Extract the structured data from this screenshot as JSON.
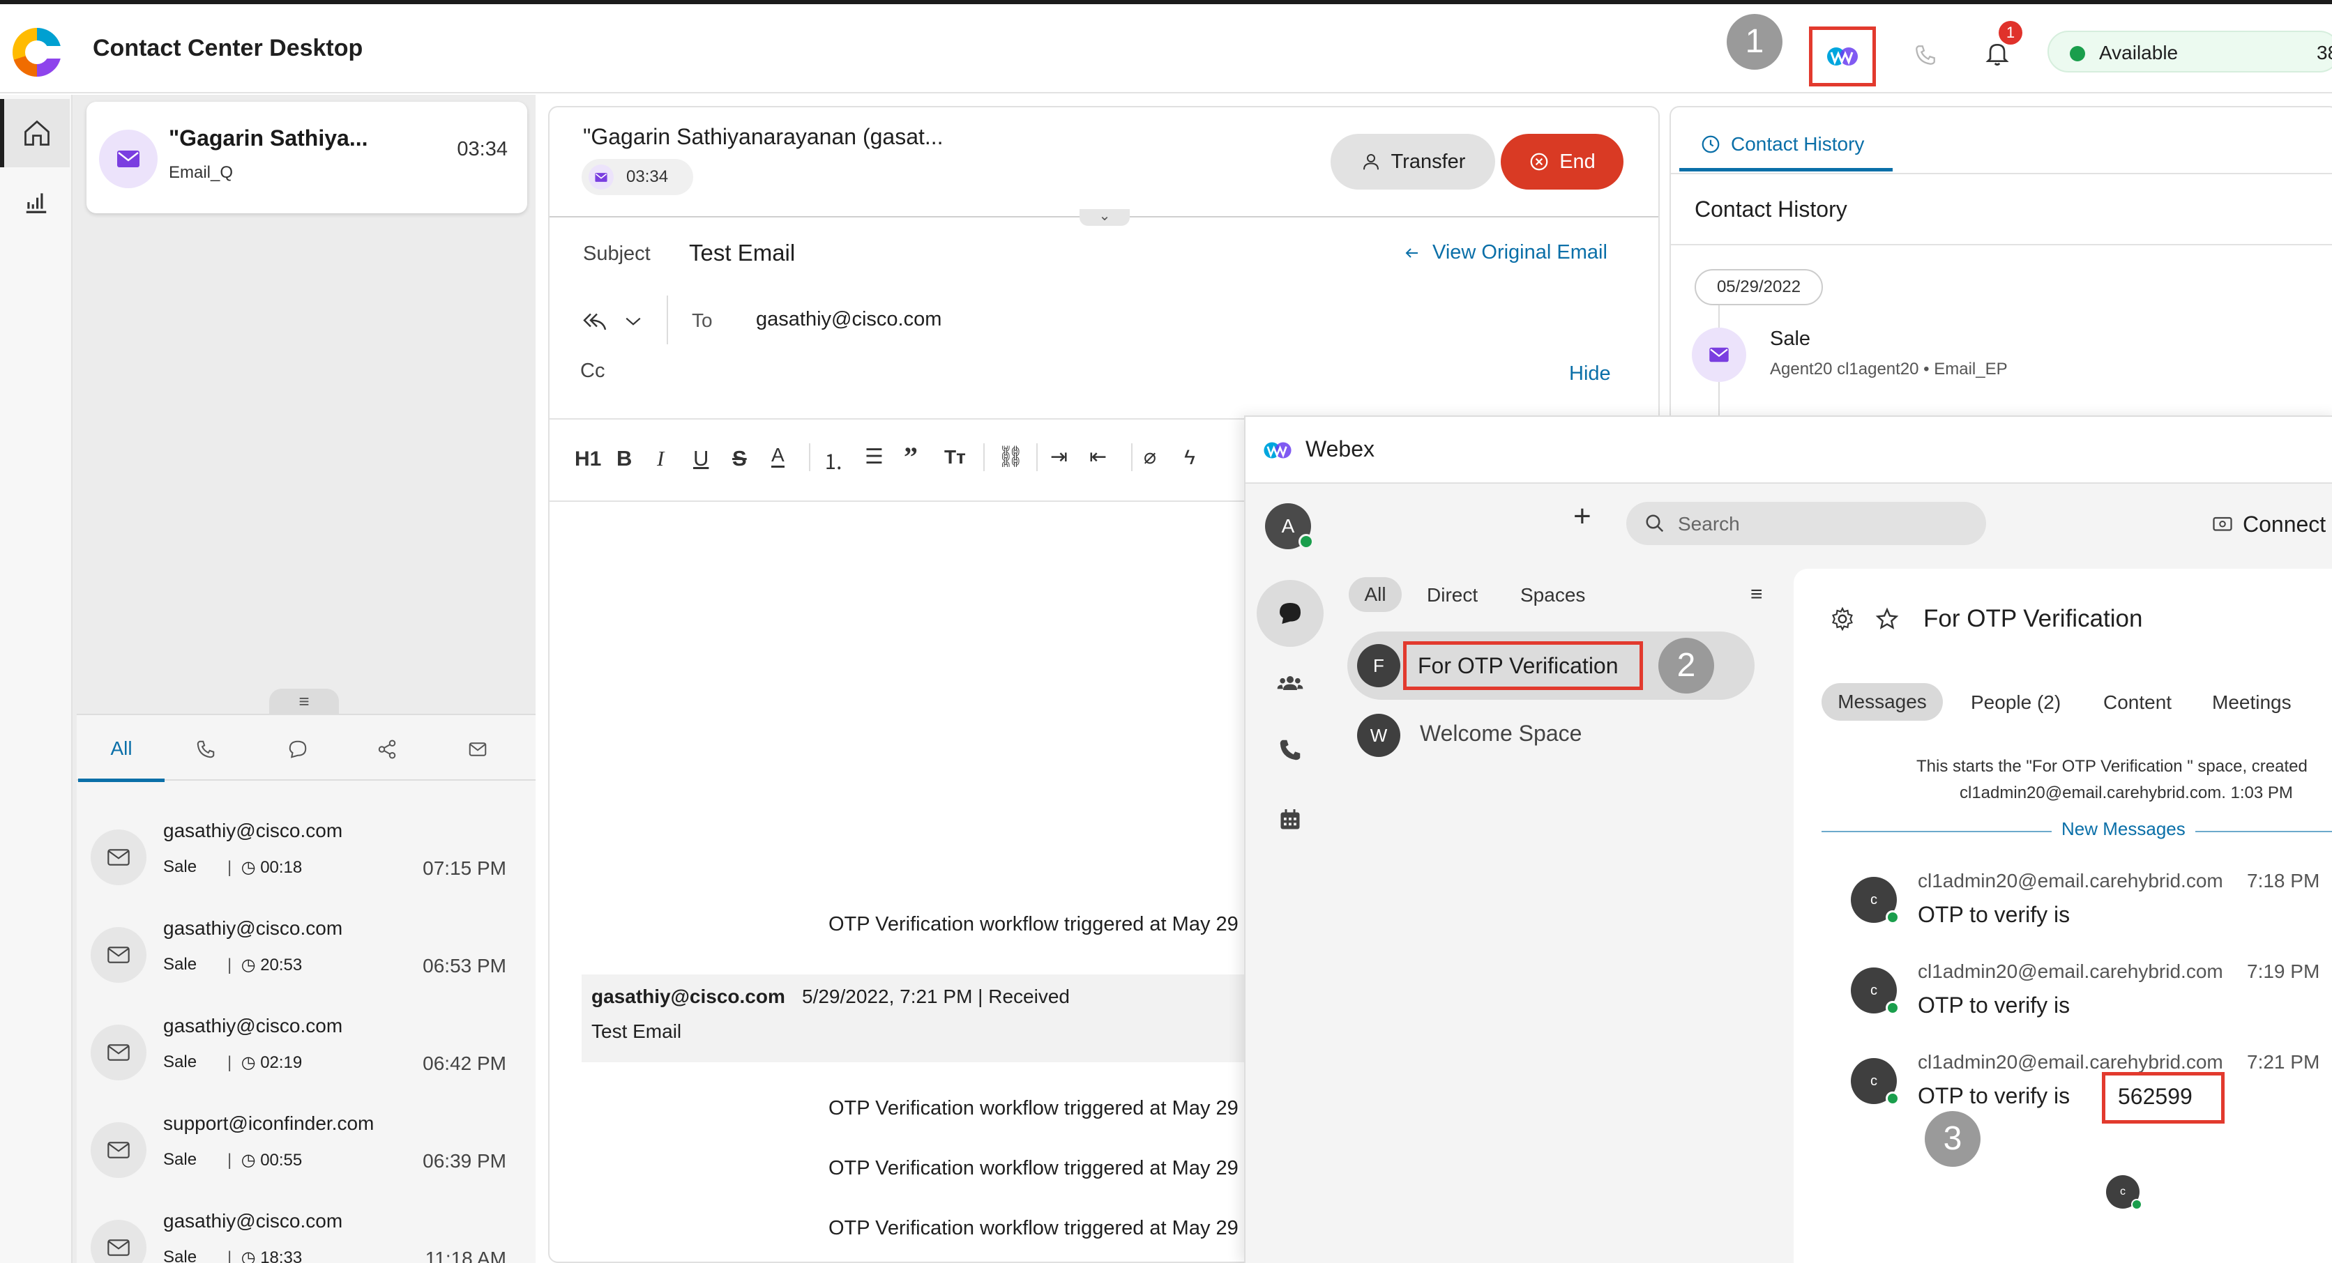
{
  "app": {
    "title": "Contact Center Desktop",
    "notification_count": "1",
    "status": "Available",
    "status_extra": "38"
  },
  "steps": [
    "1",
    "2",
    "3"
  ],
  "task": {
    "name": "\"Gagarin Sathiya...",
    "queue": "Email_Q",
    "timer": "03:34"
  },
  "history_tabs": {
    "all": "All"
  },
  "history_list": [
    {
      "email": "gasathiy@cisco.com",
      "queue": "Sale",
      "duration": "00:18",
      "time": "07:15 PM"
    },
    {
      "email": "gasathiy@cisco.com",
      "queue": "Sale",
      "duration": "20:53",
      "time": "06:53 PM"
    },
    {
      "email": "gasathiy@cisco.com",
      "queue": "Sale",
      "duration": "02:19",
      "time": "06:42 PM"
    },
    {
      "email": "support@iconfinder.com",
      "queue": "Sale",
      "duration": "00:55",
      "time": "06:39 PM"
    },
    {
      "email": "gasathiy@cisco.com",
      "queue": "Sale",
      "duration": "18:33",
      "time": "11:18 AM"
    }
  ],
  "interaction": {
    "title": "\"Gagarin Sathiyanarayanan (gasat...",
    "timer": "03:34",
    "transfer_label": "Transfer",
    "end_label": "End",
    "subject_label": "Subject",
    "subject_value": "Test Email",
    "view_original": "View Original Email",
    "to_label": "To",
    "to_value": "gasathiy@cisco.com",
    "cc_label": "Cc",
    "hide_label": "Hide",
    "h1_label": "H1",
    "workflow_line": "OTP Verification workflow triggered at May 29",
    "quoted_sender": "gasathiy@cisco.com",
    "quoted_meta": "5/29/2022, 7:21 PM | Received",
    "quoted_body": "Test Email"
  },
  "contact_history": {
    "tab_label": "Contact History",
    "heading": "Contact History",
    "date": "05/29/2022",
    "entry_title": "Sale",
    "entry_meta": "Agent20 cl1agent20 • Email_EP"
  },
  "webex": {
    "title": "Webex",
    "user_initial": "A",
    "search_placeholder": "Search",
    "connect_label": "Connect",
    "filters": [
      "All",
      "Direct",
      "Spaces"
    ],
    "spaces": [
      {
        "initial": "F",
        "name": "For OTP Verification"
      },
      {
        "initial": "W",
        "name": "Welcome Space"
      }
    ],
    "space_title": "For OTP Verification",
    "space_tabs": [
      "Messages",
      "People (2)",
      "Content",
      "Meetings"
    ],
    "intro_line1": "This starts the \"For OTP Verification \" space, created",
    "intro_line2": "cl1admin20@email.carehybrid.com. 1:03 PM",
    "new_messages": "New Messages",
    "messages": [
      {
        "initial": "c",
        "sender": "cl1admin20@email.carehybrid.com",
        "time": "7:18 PM",
        "text": "OTP to verify is",
        "code": ""
      },
      {
        "initial": "c",
        "sender": "cl1admin20@email.carehybrid.com",
        "time": "7:19 PM",
        "text": "OTP to verify is",
        "code": ""
      },
      {
        "initial": "c",
        "sender": "cl1admin20@email.carehybrid.com",
        "time": "7:21 PM",
        "text": "OTP to verify is",
        "code": "562599"
      }
    ],
    "typing_initial": "c"
  },
  "colors": {
    "accent": "#0a6fa8",
    "end_red": "#d93a24",
    "highlight_red": "#e23a2e",
    "available_green": "#1a9e4c",
    "email_purple": "#7a3ee0"
  },
  "icons": [
    "home-icon",
    "analytics-icon",
    "webex-icon",
    "phone-icon",
    "bell-icon",
    "email-icon",
    "clock-icon",
    "chat-icon",
    "share-icon",
    "reply-all-icon",
    "chevron-down-icon",
    "arrow-left-icon",
    "search-icon",
    "plus-icon",
    "gear-icon",
    "star-icon",
    "filter-icon",
    "team-icon",
    "calendar-icon"
  ]
}
